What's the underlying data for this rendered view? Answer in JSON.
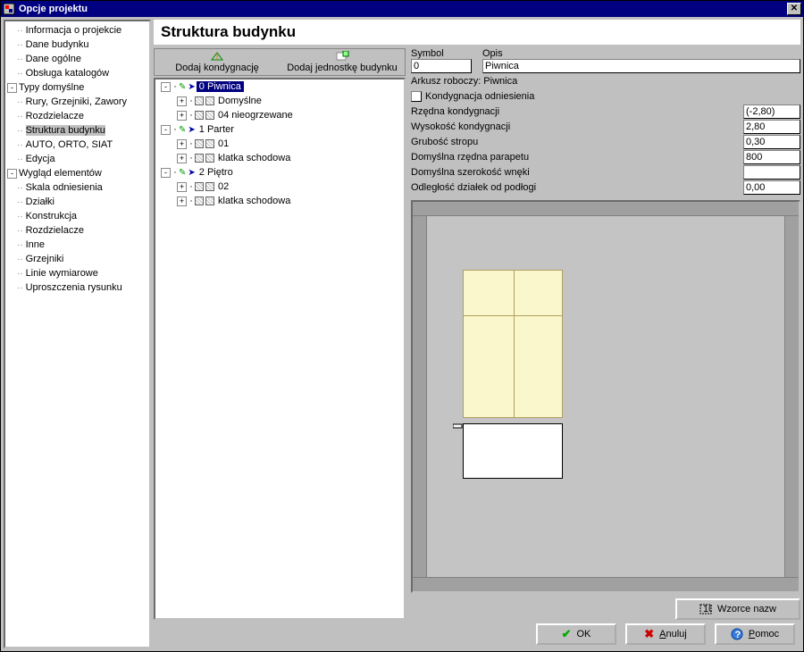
{
  "title": "Opcje projektu",
  "heading": "Struktura budynku",
  "nav": [
    {
      "level": 1,
      "exp": "",
      "text": "Informacja o projekcie",
      "sel": false
    },
    {
      "level": 1,
      "exp": "",
      "text": "Dane budynku",
      "sel": false
    },
    {
      "level": 1,
      "exp": "",
      "text": "Dane ogólne",
      "sel": false
    },
    {
      "level": 1,
      "exp": "",
      "text": "Obsługa katalogów",
      "sel": false
    },
    {
      "level": 0,
      "exp": "-",
      "text": "Typy domyślne",
      "sel": false
    },
    {
      "level": 1,
      "exp": "",
      "text": "Rury, Grzejniki, Zawory",
      "sel": false
    },
    {
      "level": 1,
      "exp": "",
      "text": "Rozdzielacze",
      "sel": false
    },
    {
      "level": 1,
      "exp": "",
      "text": "Struktura budynku",
      "sel": true
    },
    {
      "level": 1,
      "exp": "",
      "text": "AUTO, ORTO, SIAT",
      "sel": false
    },
    {
      "level": 1,
      "exp": "",
      "text": "Edycja",
      "sel": false
    },
    {
      "level": 0,
      "exp": "-",
      "text": "Wygląd elementów",
      "sel": false
    },
    {
      "level": 1,
      "exp": "",
      "text": "Skala odniesienia",
      "sel": false
    },
    {
      "level": 1,
      "exp": "",
      "text": "Działki",
      "sel": false
    },
    {
      "level": 1,
      "exp": "",
      "text": "Konstrukcja",
      "sel": false
    },
    {
      "level": 1,
      "exp": "",
      "text": "Rozdzielacze",
      "sel": false
    },
    {
      "level": 1,
      "exp": "",
      "text": "Inne",
      "sel": false
    },
    {
      "level": 1,
      "exp": "",
      "text": "Grzejniki",
      "sel": false
    },
    {
      "level": 1,
      "exp": "",
      "text": "Linie wymiarowe",
      "sel": false
    },
    {
      "level": 1,
      "exp": "",
      "text": "Uproszczenia rysunku",
      "sel": false
    }
  ],
  "toolbar": {
    "add_storey": "Dodaj kondygnację",
    "add_unit": "Dodaj jednostkę budynku"
  },
  "tree": [
    {
      "depth": 0,
      "pm": "-",
      "type": "storey",
      "text": "0 Piwnica",
      "sel": true
    },
    {
      "depth": 1,
      "pm": "+",
      "type": "unit",
      "text": "Domyślne",
      "sel": false
    },
    {
      "depth": 1,
      "pm": "+",
      "type": "unit",
      "text": "04 nieogrzewane",
      "sel": false
    },
    {
      "depth": 0,
      "pm": "-",
      "type": "storey",
      "text": "1 Parter",
      "sel": false
    },
    {
      "depth": 1,
      "pm": "+",
      "type": "unit",
      "text": "01",
      "sel": false
    },
    {
      "depth": 1,
      "pm": "+",
      "type": "unit",
      "text": "klatka schodowa",
      "sel": false
    },
    {
      "depth": 0,
      "pm": "-",
      "type": "storey",
      "text": "2 Piętro",
      "sel": false
    },
    {
      "depth": 1,
      "pm": "+",
      "type": "unit",
      "text": "02",
      "sel": false
    },
    {
      "depth": 1,
      "pm": "+",
      "type": "unit",
      "text": "klatka schodowa",
      "sel": false
    }
  ],
  "form": {
    "symbol_label": "Symbol",
    "symbol_value": "0",
    "opis_label": "Opis",
    "opis_value": "Piwnica",
    "arkusz": "Arkusz roboczy: Piwnica",
    "ref_check": "Kondygnacja odniesienia",
    "fields": [
      {
        "label": "Rzędna kondygnacji",
        "value": "(-2,80)"
      },
      {
        "label": "Wysokość kondygnacji",
        "value": "2,80"
      },
      {
        "label": "Grubość stropu",
        "value": "0,30"
      },
      {
        "label": "Domyślna rzędna parapetu",
        "value": "800"
      },
      {
        "label": "Domyślna szerokość wnęki",
        "value": ""
      },
      {
        "label": "Odległość działek od podłogi",
        "value": "0,00"
      }
    ]
  },
  "pattern_btn": "Wzorce nazw",
  "buttons": {
    "ok": "OK",
    "cancel": "Anuluj",
    "help": "Pomoc"
  }
}
